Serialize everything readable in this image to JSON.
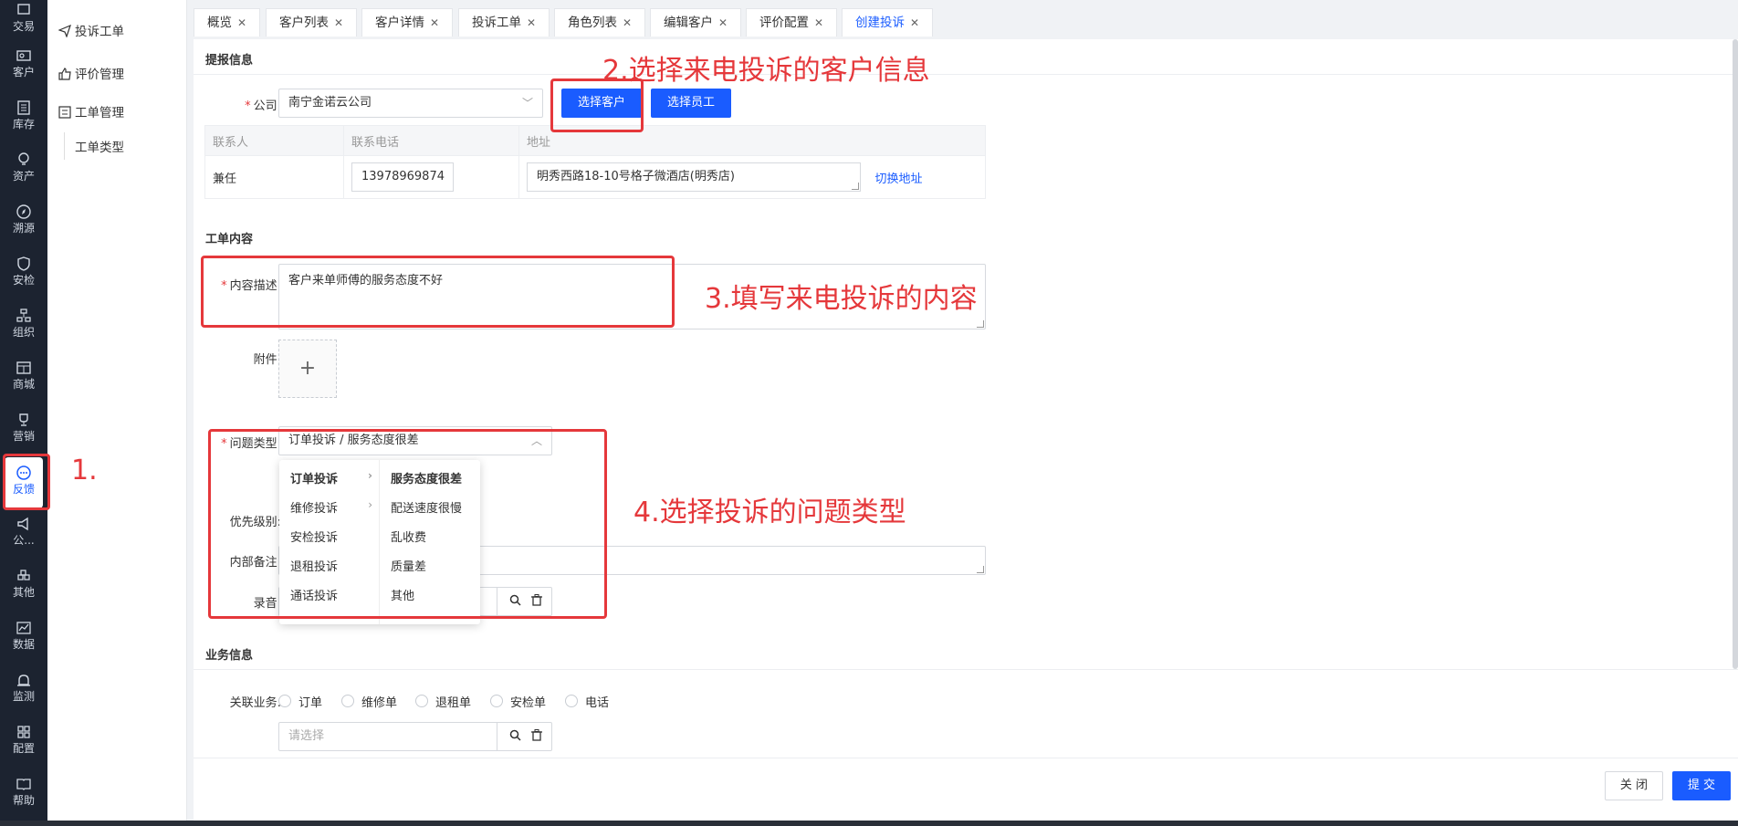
{
  "iconbar": {
    "items": [
      {
        "label": "交易",
        "icon": "cart-icon"
      },
      {
        "label": "客户",
        "icon": "contact-card-icon"
      },
      {
        "label": "库存",
        "icon": "list-doc-icon"
      },
      {
        "label": "资产",
        "icon": "bulb-icon"
      },
      {
        "label": "溯源",
        "icon": "compass-icon"
      },
      {
        "label": "安检",
        "icon": "shield-icon"
      },
      {
        "label": "组织",
        "icon": "org-icon"
      },
      {
        "label": "商城",
        "icon": "store-icon"
      },
      {
        "label": "营销",
        "icon": "trophy-icon"
      },
      {
        "label": "反馈",
        "icon": "chat-bubble-icon"
      },
      {
        "label": "公...",
        "icon": "megaphone-icon"
      },
      {
        "label": "其他",
        "icon": "apps-icon"
      },
      {
        "label": "数据",
        "icon": "chart-icon"
      },
      {
        "label": "监测",
        "icon": "alarm-icon"
      },
      {
        "label": "配置",
        "icon": "grid-icon"
      },
      {
        "label": "帮助",
        "icon": "book-icon"
      }
    ],
    "active_index": 9
  },
  "submenu": {
    "complaint": "投诉工单",
    "evaluation": "评价管理",
    "workorder": "工单管理",
    "workorder_type": "工单类型"
  },
  "tabs": [
    {
      "label": "概览",
      "active": false
    },
    {
      "label": "客户列表",
      "active": false
    },
    {
      "label": "客户详情",
      "active": false
    },
    {
      "label": "投诉工单",
      "active": false
    },
    {
      "label": "角色列表",
      "active": false
    },
    {
      "label": "编辑客户",
      "active": false
    },
    {
      "label": "评价配置",
      "active": false
    },
    {
      "label": "创建投诉",
      "active": true
    }
  ],
  "report": {
    "section_title": "提报信息",
    "company_label": "公司:",
    "company_value": "南宁金诺云公司",
    "select_customer": "选择客户",
    "select_staff": "选择员工",
    "table_headers": [
      "联系人",
      "联系电话",
      "地址"
    ],
    "contact_name": "兼任",
    "contact_phone": "13978969874",
    "contact_address": "明秀西路18-10号格子微酒店(明秀店)",
    "switch_address": "切换地址"
  },
  "workorder": {
    "section_title": "工单内容",
    "desc_label": "内容描述:",
    "desc_value": "客户来单师傅的服务态度不好",
    "attach_label": "附件:",
    "attach_plus": "+",
    "issue_label": "问题类型:",
    "issue_value": "订单投诉 / 服务态度很差",
    "priority_label": "优先级别:",
    "remark_label": "内部备注:",
    "record_label": "录音:"
  },
  "cascader": {
    "level1": [
      "订单投诉",
      "维修投诉",
      "安检投诉",
      "退租投诉",
      "通话投诉"
    ],
    "level2": [
      "服务态度很差",
      "配送速度很慢",
      "乱收费",
      "质量差",
      "其他"
    ]
  },
  "business": {
    "section_title": "业务信息",
    "related_label": "关联业务:",
    "options": [
      "订单",
      "维修单",
      "退租单",
      "安检单",
      "电话"
    ],
    "select_placeholder": "请选择"
  },
  "footer": {
    "close": "关 闭",
    "submit": "提 交"
  },
  "annotations": {
    "step1": "1.",
    "step2": "2.选择来电投诉的客户信息",
    "step3": "3.填写来电投诉的内容",
    "step4": "4.选择投诉的问题类型"
  },
  "colors": {
    "primary": "#1a5cff",
    "annotation": "#e5383b",
    "sidebar": "#1c2330"
  }
}
